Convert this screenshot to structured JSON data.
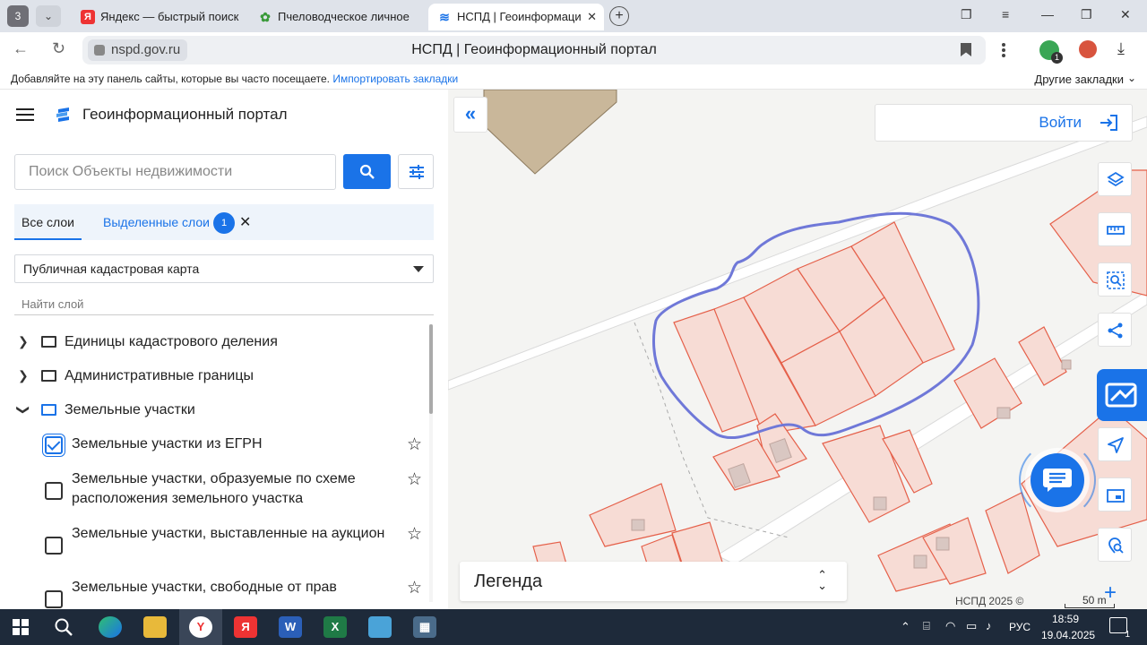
{
  "browser": {
    "tab_counter": "3",
    "tabs": [
      {
        "title": "Яндекс — быстрый поиск",
        "favicon": "Я"
      },
      {
        "title": "Пчеловодческое личное",
        "favicon": "leaf"
      },
      {
        "title": "НСПД | Геоинформаци",
        "favicon": "nspd"
      }
    ],
    "domain": "nspd.gov.ru",
    "page_title": "НСПД | Геоинформационный портал",
    "bookmarks_hint": "Добавляйте на эту панель сайты, которые вы часто посещаете.",
    "bookmarks_import": "Импортировать закладки",
    "other_bookmarks": "Другие закладки",
    "shield_badge": "1"
  },
  "sidebar": {
    "portal_title": "Геоинформационный портал",
    "search_placeholder": "Поиск Объекты недвижимости",
    "tabs": {
      "all": "Все слои",
      "selected": "Выделенные слои",
      "selected_count": "1"
    },
    "map_select": "Публичная кадастровая карта",
    "find_layer": "Найти слой",
    "tree": [
      {
        "label": "Единицы кадастрового деления",
        "expanded": false
      },
      {
        "label": "Административные границы",
        "expanded": false
      },
      {
        "label": "Земельные участки",
        "expanded": true
      }
    ],
    "layers": [
      {
        "label": "Земельные участки из ЕГРН",
        "checked": true
      },
      {
        "label": "Земельные участки, образуемые по схеме расположения земельного участка",
        "checked": false
      },
      {
        "label": "Земельные участки, выставленные на аукцион",
        "checked": false
      },
      {
        "label": "Земельные участки, свободные от прав",
        "checked": false
      }
    ]
  },
  "map": {
    "login": "Войти",
    "legend": "Легенда",
    "copyright": "НСПД 2025 ©",
    "scale": "50 m",
    "colors": {
      "parcel_stroke": "#e5604a",
      "parcel_fill": "#f7dcd5",
      "drawn_outline": "#6f78d8",
      "building": "#c9b79a"
    }
  },
  "taskbar": {
    "lang": "РУС",
    "time": "18:59",
    "date": "19.04.2025",
    "notifications": "1"
  }
}
